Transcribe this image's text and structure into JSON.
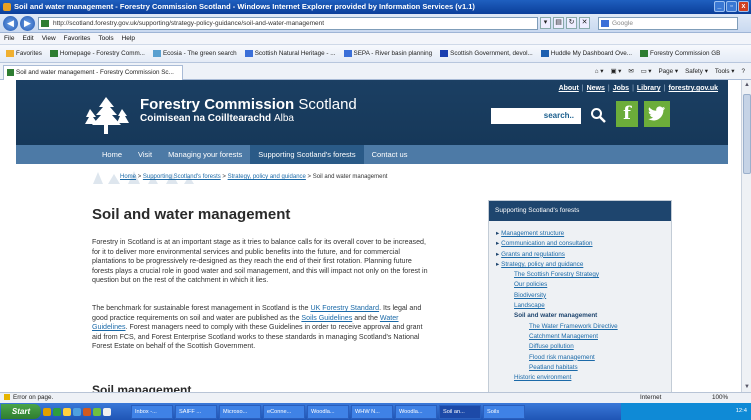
{
  "window": {
    "title": "Soil and water management - Forestry Commission Scotland - Windows Internet Explorer provided by Information Services (v1.1)",
    "controls": [
      "_",
      "▫",
      "x"
    ]
  },
  "address_bar": {
    "url": "http://scotland.forestry.gov.uk/supporting/strategy-policy-guidance/soil-and-water-management",
    "search_placeholder": "Google"
  },
  "menu": [
    "File",
    "Edit",
    "View",
    "Favorites",
    "Tools",
    "Help"
  ],
  "favorites_bar": {
    "label": "Favorites",
    "items": [
      "Homepage - Forestry Comm...",
      "Ecosia - The green search",
      "Scottish Natural Heritage - ...",
      "SEPA - River basin planning",
      "Scottish Government, devol...",
      "Huddle My Dashboard Ove...",
      "Forestry Commission GB"
    ]
  },
  "tab": {
    "label": "Soil and water management - Forestry Commission Sc..."
  },
  "command_bar": [
    "Page ▾",
    "Safety ▾",
    "Tools ▾"
  ],
  "site": {
    "top_links": [
      "About",
      "News",
      "Jobs",
      "Library",
      "forestry.gov.uk"
    ],
    "brand_bold": "Forestry Commission",
    "brand_light": "Scotland",
    "brand2_bold": "Coimisean na Coilltearachd",
    "brand2_light": "Alba",
    "search_label": "search..",
    "facebook": "f",
    "nav": [
      "Home",
      "Visit",
      "Managing your forests",
      "Supporting Scotland's forests",
      "Contact us"
    ],
    "nav_active_index": 3
  },
  "breadcrumb": [
    "Home",
    "Supporting Scotland's forests",
    "Strategy, policy and guidance",
    "Soil and water management"
  ],
  "breadcrumb_sep": ">",
  "content": {
    "title": "Soil and water management",
    "para1": "Forestry in Scotland is at an important stage as it tries to balance calls for its overall cover to be increased, for it to deliver more environmental services and public benefits into the future, and for commercial plantations to be progressively re-designed as they reach the end of their first rotation. Planning future forests plays a crucial role in good water and soil management, and this will impact not only on the forest in question but on the rest of the catchment in which it lies.",
    "para2_a": "The benchmark for sustainable forest management in Scotland is the ",
    "para2_link1": "UK Forestry Standard",
    "para2_b": ". Its legal and good practice requirements on soil and water are published as the ",
    "para2_link2": "Soils Guidelines",
    "para2_c": " and the ",
    "para2_link3": "Water Guidelines",
    "para2_d": ". Forest managers need to comply with these Guidelines in order to receive approval and grant aid from FCS, and Forest Enterprise Scotland works to these standards in managing Scotland's National Forest Estate on behalf of the Scottish Government.",
    "subheading": "Soil management"
  },
  "sidebar": {
    "title": "Supporting Scotland's forests",
    "items": [
      {
        "label": "Management structure",
        "level": 1
      },
      {
        "label": "Communication and consultation",
        "level": 1
      },
      {
        "label": "Grants and regulations",
        "level": 1
      },
      {
        "label": "Strategy, policy and guidance",
        "level": 1
      },
      {
        "label": "The Scottish Forestry Strategy",
        "level": 2
      },
      {
        "label": "Our policies",
        "level": 2
      },
      {
        "label": "Biodiversity",
        "level": 2
      },
      {
        "label": "Landscape",
        "level": 2
      },
      {
        "label": "Soil and water management",
        "level": 2,
        "current": true
      },
      {
        "label": "The Water Framework Directive",
        "level": 3
      },
      {
        "label": "Catchment Management",
        "level": 3
      },
      {
        "label": "Diffuse pollution",
        "level": 3
      },
      {
        "label": "Flood risk management",
        "level": 3
      },
      {
        "label": "Peatland habitats",
        "level": 3
      },
      {
        "label": "Historic environment",
        "level": 2
      }
    ]
  },
  "status": {
    "left": "Error on page.",
    "zone": "Internet",
    "zoom": "100%"
  },
  "taskbar": {
    "start": "Start",
    "buttons": [
      "Inbox -...",
      "SAIFF ...",
      "Microso...",
      "eConne...",
      "Woodla...",
      "WHW N...",
      "Woodla...",
      "Soil an...",
      "Soils"
    ],
    "active_index": 7,
    "clock": "12:4"
  }
}
